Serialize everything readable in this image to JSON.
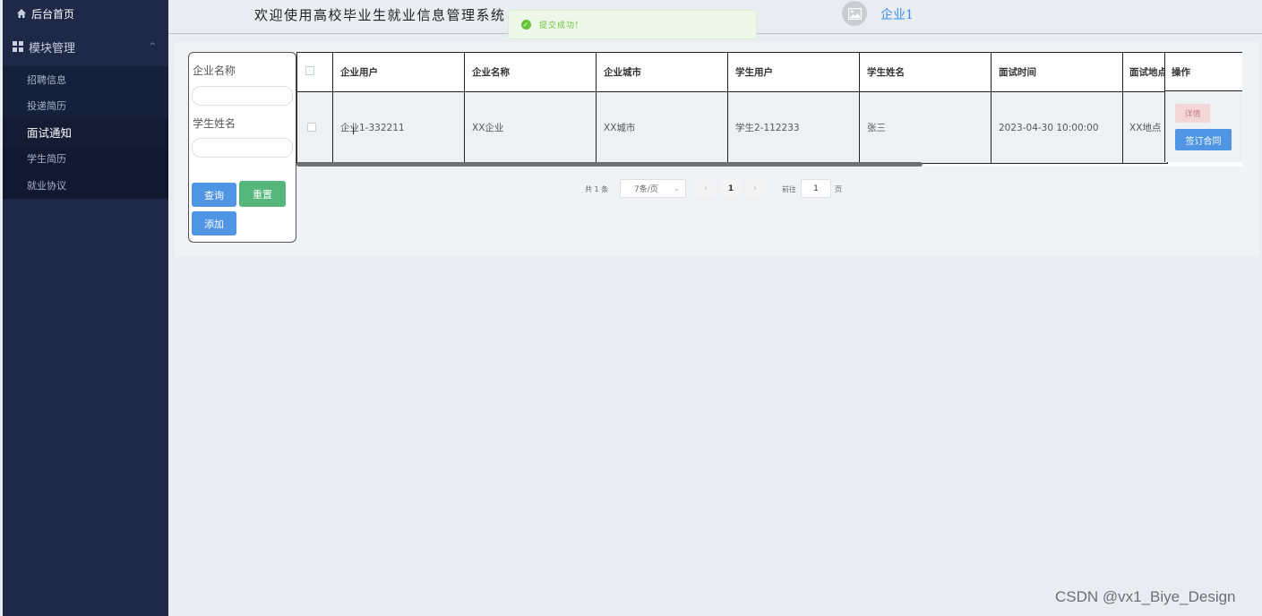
{
  "sidebar": {
    "home_label": "后台首页",
    "group_label": "模块管理",
    "group_chevron": "^",
    "items": [
      {
        "label": "招聘信息"
      },
      {
        "label": "投递简历"
      },
      {
        "label": "面试通知"
      },
      {
        "label": "学生简历"
      },
      {
        "label": "就业协议"
      }
    ]
  },
  "header": {
    "title": "欢迎使用高校毕业生就业信息管理系统",
    "username": "企业1"
  },
  "toast": {
    "message": "提交成功!",
    "icon": "check-circle-icon",
    "color": "#67c23a"
  },
  "search": {
    "company_label": "企业名称",
    "company_value": "",
    "student_label": "学生姓名",
    "student_value": "",
    "query_label": "查询",
    "reset_label": "重置",
    "add_label": "添加"
  },
  "table": {
    "columns": [
      "企业用户",
      "企业名称",
      "企业城市",
      "学生用户",
      "学生姓名",
      "面试时间",
      "面试地点"
    ],
    "ops_header": "操作",
    "rows": [
      {
        "company_user": "企业1-332211",
        "company_name": "XX企业",
        "company_city": "XX城市",
        "student_user": "学生2-112233",
        "student_name": "张三",
        "interview_time": "2023-04-30 10:00:00",
        "interview_place": "XX地点",
        "detail_label": "详情",
        "sign_label": "签订合同"
      }
    ]
  },
  "pagination": {
    "total_text": "共 1 条",
    "page_size": "7条/页",
    "current_page": "1",
    "goto_label": "前往",
    "goto_value": "1",
    "page_suffix": "页"
  },
  "colors": {
    "sidebar_bg": "#1f2947",
    "primary": "#4f95e4",
    "success": "#55b77c",
    "danger_light": "#f3d6d6"
  },
  "watermark": "CSDN @vx1_Biye_Design"
}
